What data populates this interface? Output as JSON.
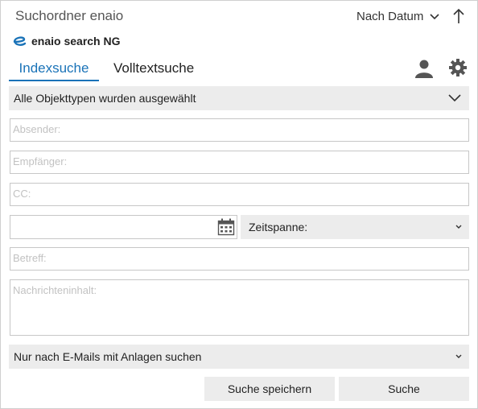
{
  "window": {
    "title": "Suchordner enaio",
    "sort_label": "Nach Datum"
  },
  "brand": {
    "name": "enaio search NG",
    "logo_icon": "enaio-e-logo",
    "accent_color": "#1a73b8"
  },
  "tabs": [
    {
      "label": "Indexsuche",
      "active": true
    },
    {
      "label": "Volltextsuche",
      "active": false
    }
  ],
  "object_type_select": {
    "value": "Alle Objekttypen wurden ausgewählt"
  },
  "fields": {
    "sender_placeholder": "Absender:",
    "recipient_placeholder": "Empfänger:",
    "cc_placeholder": "CC:",
    "subject_placeholder": "Betreff:",
    "body_placeholder": "Nachrichteninhalt:"
  },
  "date": {
    "value": "",
    "range_label": "Zeitspanne:"
  },
  "attachments_select": {
    "value": "Nur nach E-Mails mit Anlagen suchen"
  },
  "buttons": {
    "save_search": "Suche speichern",
    "search": "Suche"
  }
}
